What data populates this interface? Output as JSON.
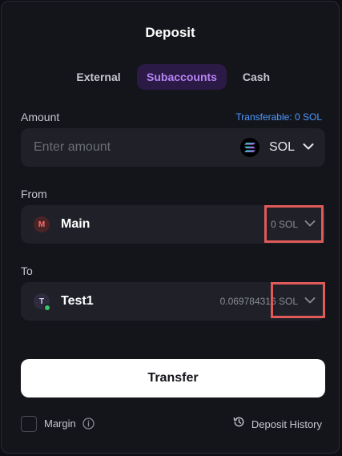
{
  "dialog": {
    "title": "Deposit",
    "tabs": [
      {
        "label": "External",
        "active": false
      },
      {
        "label": "Subaccounts",
        "active": true
      },
      {
        "label": "Cash",
        "active": false
      }
    ]
  },
  "amount": {
    "label": "Amount",
    "transferable": "Transferable: 0 SOL",
    "placeholder": "Enter amount",
    "value": "",
    "token": "SOL",
    "token_icon": "solana-logo-icon"
  },
  "from": {
    "label": "From",
    "avatar_letter": "M",
    "account": "Main",
    "balance": "0 SOL"
  },
  "to": {
    "label": "To",
    "avatar_letter": "T",
    "account": "Test1",
    "balance": "0.069784316 SOL"
  },
  "actions": {
    "transfer_label": "Transfer"
  },
  "footer": {
    "margin_label": "Margin",
    "margin_checked": false,
    "history_label": "Deposit History"
  },
  "colors": {
    "accent_purple": "#b884f4",
    "link_blue": "#4d9bff",
    "highlight_red": "#e05a5a",
    "background": "#14151b"
  }
}
